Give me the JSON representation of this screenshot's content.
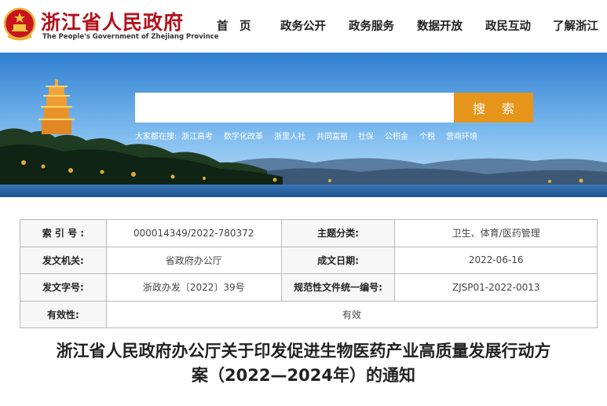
{
  "site": {
    "name_cn": "浙江省人民政府",
    "name_en": "The People's Government of Zhejiang Province"
  },
  "nav": {
    "items": [
      {
        "label": "首　页"
      },
      {
        "label": "政务公开"
      },
      {
        "label": "政务服务"
      },
      {
        "label": "数据开放"
      },
      {
        "label": "政民互动"
      },
      {
        "label": "了解浙江"
      }
    ]
  },
  "search": {
    "value": "",
    "placeholder": "",
    "button_label": "搜 索",
    "hot_prefix": "大家都在搜:",
    "hot_terms": [
      "浙江高考",
      "数字化改革",
      "浙里人社",
      "共同富裕",
      "社保",
      "公积金",
      "个税",
      "营商环境"
    ]
  },
  "info_table": {
    "rows": [
      [
        {
          "label": "索 引 号 :",
          "value": "000014349/2022-780372"
        },
        {
          "label": "主题分类:",
          "value": "卫生、体育/医药管理"
        }
      ],
      [
        {
          "label": "发文机关:",
          "value": "省政府办公厅"
        },
        {
          "label": "成文日期:",
          "value": "2022-06-16"
        }
      ],
      [
        {
          "label": "发文字号:",
          "value": "浙政办发〔2022〕39号"
        },
        {
          "label": "规范性文件统一编号:",
          "value": "ZJSP01-2022-0013"
        }
      ]
    ],
    "validity": {
      "label": "有效性:",
      "value": "有效"
    }
  },
  "document": {
    "title_line1": "浙江省人民政府办公厅关于印发促进生物医药产业高质量发展行动方",
    "title_line2": "案（2022—2024年）的通知"
  },
  "colors": {
    "brand_red": "#b3121b",
    "search_orange": "#e6951b",
    "sky_top": "#2f7fd0"
  }
}
